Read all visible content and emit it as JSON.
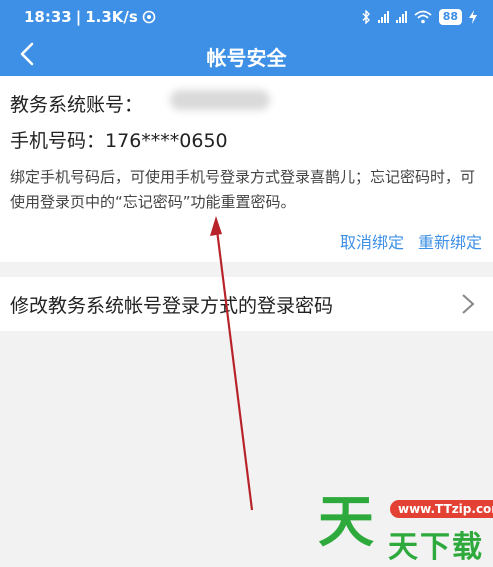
{
  "status_bar": {
    "time": "18:33",
    "speed": "1.3K/s",
    "battery": "88"
  },
  "header": {
    "title": "帐号安全"
  },
  "account": {
    "label": "教务系统账号：",
    "phone_label": "手机号码：",
    "phone_value": "176****0650",
    "description": "绑定手机号码后，可使用手机号登录方式登录喜鹊儿；忘记密码时，可使用登录页中的“忘记密码”功能重置密码。",
    "unbind": "取消绑定",
    "rebind": "重新绑定"
  },
  "password_item": {
    "label": "修改教务系统帐号登录方式的登录密码"
  },
  "watermark": {
    "url": "www.TTzip.com",
    "big_char": "天",
    "small_text": "天下载"
  },
  "colors": {
    "header_bg": "#3d90e6",
    "link": "#3d90e6",
    "arrow": "#b8232a",
    "watermark_green": "#2eaa3c",
    "watermark_red": "#e34133"
  }
}
